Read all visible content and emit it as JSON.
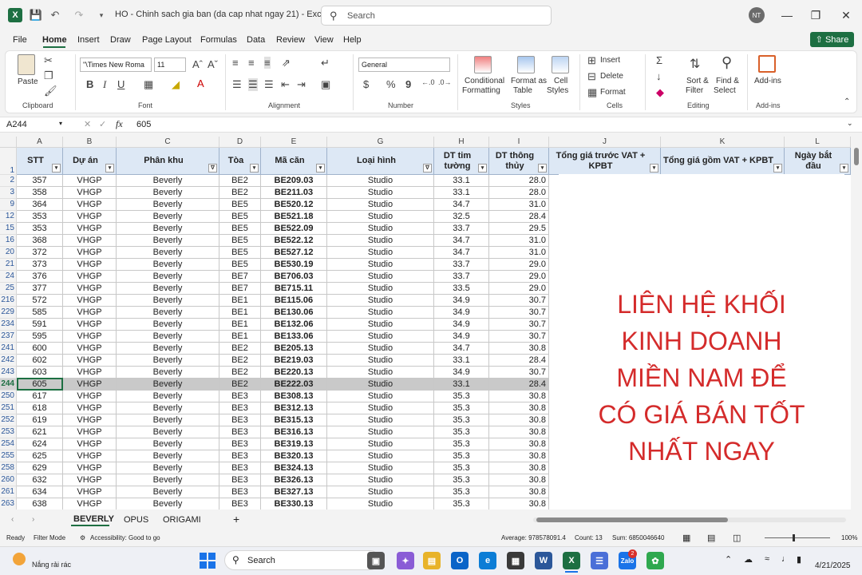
{
  "titlebar": {
    "doc_title": "HO - Chinh sach gia ban (da cap nhat ngay 21)  -  Excel",
    "search_placeholder": "Search",
    "avatar_initials": "NT",
    "minimize": "—",
    "restore": "❐",
    "close": "✕"
  },
  "menu": {
    "tabs": [
      "File",
      "Home",
      "Insert",
      "Draw",
      "Page Layout",
      "Formulas",
      "Data",
      "Review",
      "View",
      "Help"
    ],
    "share": "Share"
  },
  "ribbon": {
    "clipboard": {
      "paste": "Paste",
      "label": "Clipboard"
    },
    "font": {
      "family": "\"\\Times New Roma",
      "size": "11",
      "label": "Font",
      "bold": "B",
      "italic": "I",
      "underline": "U"
    },
    "alignment": {
      "label": "Alignment"
    },
    "number": {
      "format": "General",
      "label": "Number",
      "currency": "$",
      "percent": "%",
      "comma": "9"
    },
    "styles": {
      "conditional": [
        "Conditional",
        "Formatting"
      ],
      "format_table": [
        "Format as",
        "Table"
      ],
      "cell_styles": [
        "Cell",
        "Styles"
      ],
      "label": "Styles"
    },
    "cells": {
      "insert": "Insert",
      "delete": "Delete",
      "format": "Format",
      "label": "Cells"
    },
    "editing": {
      "sort": [
        "Sort &",
        "Filter"
      ],
      "find": [
        "Find &",
        "Select"
      ],
      "label": "Editing"
    },
    "addins": {
      "name": "Add-ins",
      "label": "Add-ins"
    }
  },
  "formula_bar": {
    "name_box": "A244",
    "fx": "fx",
    "value": "605"
  },
  "columns": [
    {
      "letter": "A",
      "header": "STT",
      "filter": "▾"
    },
    {
      "letter": "B",
      "header": "Dự án",
      "filter": "▾"
    },
    {
      "letter": "C",
      "header": "Phân khu",
      "filter": "∇"
    },
    {
      "letter": "D",
      "header": "Tòa",
      "filter": "▾"
    },
    {
      "letter": "E",
      "header": "Mã căn",
      "filter": "▾"
    },
    {
      "letter": "G",
      "header": "Loại hình",
      "filter": "∇"
    },
    {
      "letter": "H",
      "header": "DT tim tường",
      "filter": "▾"
    },
    {
      "letter": "I",
      "header": "DT thông thủy",
      "filter": "▾"
    },
    {
      "letter": "J",
      "header": "Tổng giá trước VAT + KPBT",
      "filter": "▾"
    },
    {
      "letter": "K",
      "header": "Tổng giá gồm VAT + KPBT",
      "filter": "▾"
    },
    {
      "letter": "L",
      "header": "Ngày bắt đầu",
      "filter": "▾"
    }
  ],
  "header_row_number": "1",
  "rows": [
    {
      "n": "2",
      "stt": "357",
      "da": "VHGP",
      "pk": "Beverly",
      "toa": "BE2",
      "ma": "BE209.03",
      "lh": "Studio",
      "dtt": "33.1",
      "dtth": "28.0"
    },
    {
      "n": "3",
      "stt": "358",
      "da": "VHGP",
      "pk": "Beverly",
      "toa": "BE2",
      "ma": "BE211.03",
      "lh": "Studio",
      "dtt": "33.1",
      "dtth": "28.0"
    },
    {
      "n": "9",
      "stt": "364",
      "da": "VHGP",
      "pk": "Beverly",
      "toa": "BE5",
      "ma": "BE520.12",
      "lh": "Studio",
      "dtt": "34.7",
      "dtth": "31.0"
    },
    {
      "n": "12",
      "stt": "353",
      "da": "VHGP",
      "pk": "Beverly",
      "toa": "BE5",
      "ma": "BE521.18",
      "lh": "Studio",
      "dtt": "32.5",
      "dtth": "28.4"
    },
    {
      "n": "15",
      "stt": "353",
      "da": "VHGP",
      "pk": "Beverly",
      "toa": "BE5",
      "ma": "BE522.09",
      "lh": "Studio",
      "dtt": "33.7",
      "dtth": "29.5"
    },
    {
      "n": "16",
      "stt": "368",
      "da": "VHGP",
      "pk": "Beverly",
      "toa": "BE5",
      "ma": "BE522.12",
      "lh": "Studio",
      "dtt": "34.7",
      "dtth": "31.0"
    },
    {
      "n": "20",
      "stt": "372",
      "da": "VHGP",
      "pk": "Beverly",
      "toa": "BE5",
      "ma": "BE527.12",
      "lh": "Studio",
      "dtt": "34.7",
      "dtth": "31.0"
    },
    {
      "n": "21",
      "stt": "373",
      "da": "VHGP",
      "pk": "Beverly",
      "toa": "BE5",
      "ma": "BE530.19",
      "lh": "Studio",
      "dtt": "33.7",
      "dtth": "29.0"
    },
    {
      "n": "24",
      "stt": "376",
      "da": "VHGP",
      "pk": "Beverly",
      "toa": "BE7",
      "ma": "BE706.03",
      "lh": "Studio",
      "dtt": "33.7",
      "dtth": "29.0"
    },
    {
      "n": "25",
      "stt": "377",
      "da": "VHGP",
      "pk": "Beverly",
      "toa": "BE7",
      "ma": "BE715.11",
      "lh": "Studio",
      "dtt": "33.5",
      "dtth": "29.0"
    },
    {
      "n": "216",
      "stt": "572",
      "da": "VHGP",
      "pk": "Beverly",
      "toa": "BE1",
      "ma": "BE115.06",
      "lh": "Studio",
      "dtt": "34.9",
      "dtth": "30.7"
    },
    {
      "n": "229",
      "stt": "585",
      "da": "VHGP",
      "pk": "Beverly",
      "toa": "BE1",
      "ma": "BE130.06",
      "lh": "Studio",
      "dtt": "34.9",
      "dtth": "30.7"
    },
    {
      "n": "234",
      "stt": "591",
      "da": "VHGP",
      "pk": "Beverly",
      "toa": "BE1",
      "ma": "BE132.06",
      "lh": "Studio",
      "dtt": "34.9",
      "dtth": "30.7"
    },
    {
      "n": "237",
      "stt": "595",
      "da": "VHGP",
      "pk": "Beverly",
      "toa": "BE1",
      "ma": "BE133.06",
      "lh": "Studio",
      "dtt": "34.9",
      "dtth": "30.7"
    },
    {
      "n": "241",
      "stt": "600",
      "da": "VHGP",
      "pk": "Beverly",
      "toa": "BE2",
      "ma": "BE205.13",
      "lh": "Studio",
      "dtt": "34.7",
      "dtth": "30.8"
    },
    {
      "n": "242",
      "stt": "602",
      "da": "VHGP",
      "pk": "Beverly",
      "toa": "BE2",
      "ma": "BE219.03",
      "lh": "Studio",
      "dtt": "33.1",
      "dtth": "28.4"
    },
    {
      "n": "243",
      "stt": "603",
      "da": "VHGP",
      "pk": "Beverly",
      "toa": "BE2",
      "ma": "BE220.13",
      "lh": "Studio",
      "dtt": "34.9",
      "dtth": "30.7"
    },
    {
      "n": "244",
      "stt": "605",
      "da": "VHGP",
      "pk": "Beverly",
      "toa": "BE2",
      "ma": "BE222.03",
      "lh": "Studio",
      "dtt": "33.1",
      "dtth": "28.4",
      "selected": true
    },
    {
      "n": "250",
      "stt": "617",
      "da": "VHGP",
      "pk": "Beverly",
      "toa": "BE3",
      "ma": "BE308.13",
      "lh": "Studio",
      "dtt": "35.3",
      "dtth": "30.8"
    },
    {
      "n": "251",
      "stt": "618",
      "da": "VHGP",
      "pk": "Beverly",
      "toa": "BE3",
      "ma": "BE312.13",
      "lh": "Studio",
      "dtt": "35.3",
      "dtth": "30.8"
    },
    {
      "n": "252",
      "stt": "619",
      "da": "VHGP",
      "pk": "Beverly",
      "toa": "BE3",
      "ma": "BE315.13",
      "lh": "Studio",
      "dtt": "35.3",
      "dtth": "30.8"
    },
    {
      "n": "253",
      "stt": "621",
      "da": "VHGP",
      "pk": "Beverly",
      "toa": "BE3",
      "ma": "BE316.13",
      "lh": "Studio",
      "dtt": "35.3",
      "dtth": "30.8"
    },
    {
      "n": "254",
      "stt": "624",
      "da": "VHGP",
      "pk": "Beverly",
      "toa": "BE3",
      "ma": "BE319.13",
      "lh": "Studio",
      "dtt": "35.3",
      "dtth": "30.8"
    },
    {
      "n": "255",
      "stt": "625",
      "da": "VHGP",
      "pk": "Beverly",
      "toa": "BE3",
      "ma": "BE320.13",
      "lh": "Studio",
      "dtt": "35.3",
      "dtth": "30.8"
    },
    {
      "n": "258",
      "stt": "629",
      "da": "VHGP",
      "pk": "Beverly",
      "toa": "BE3",
      "ma": "BE324.13",
      "lh": "Studio",
      "dtt": "35.3",
      "dtth": "30.8"
    },
    {
      "n": "260",
      "stt": "632",
      "da": "VHGP",
      "pk": "Beverly",
      "toa": "BE3",
      "ma": "BE326.13",
      "lh": "Studio",
      "dtt": "35.3",
      "dtth": "30.8"
    },
    {
      "n": "261",
      "stt": "634",
      "da": "VHGP",
      "pk": "Beverly",
      "toa": "BE3",
      "ma": "BE327.13",
      "lh": "Studio",
      "dtt": "35.3",
      "dtth": "30.8"
    },
    {
      "n": "263",
      "stt": "638",
      "da": "VHGP",
      "pk": "Beverly",
      "toa": "BE3",
      "ma": "BE330.13",
      "lh": "Studio",
      "dtt": "35.3",
      "dtth": "30.8"
    }
  ],
  "overlay_lines": [
    "LIÊN HỆ KHỐI",
    "KINH DOANH",
    "MIỀN NAM ĐỂ",
    "CÓ GIÁ BÁN TỐT",
    "NHẤT NGAY"
  ],
  "sheets": [
    "BEVERLY",
    "OPUS",
    "ORIGAMI"
  ],
  "add_sheet": "+",
  "status": {
    "ready": "Ready",
    "filter_mode": "Filter Mode",
    "accessibility": "Accessibility: Good to go",
    "average": "Average: 978578091.4",
    "count": "Count: 13",
    "sum": "Sum: 6850046640",
    "zoom": "100%"
  },
  "taskbar": {
    "weather": "Nắng rải rác",
    "search": "Search",
    "date": "4/21/2025",
    "zalo_badge": "2"
  },
  "colors": {
    "excel_green": "#1d6f42",
    "overlay_red": "#d42b2b",
    "header_fill": "#dde8f5"
  }
}
